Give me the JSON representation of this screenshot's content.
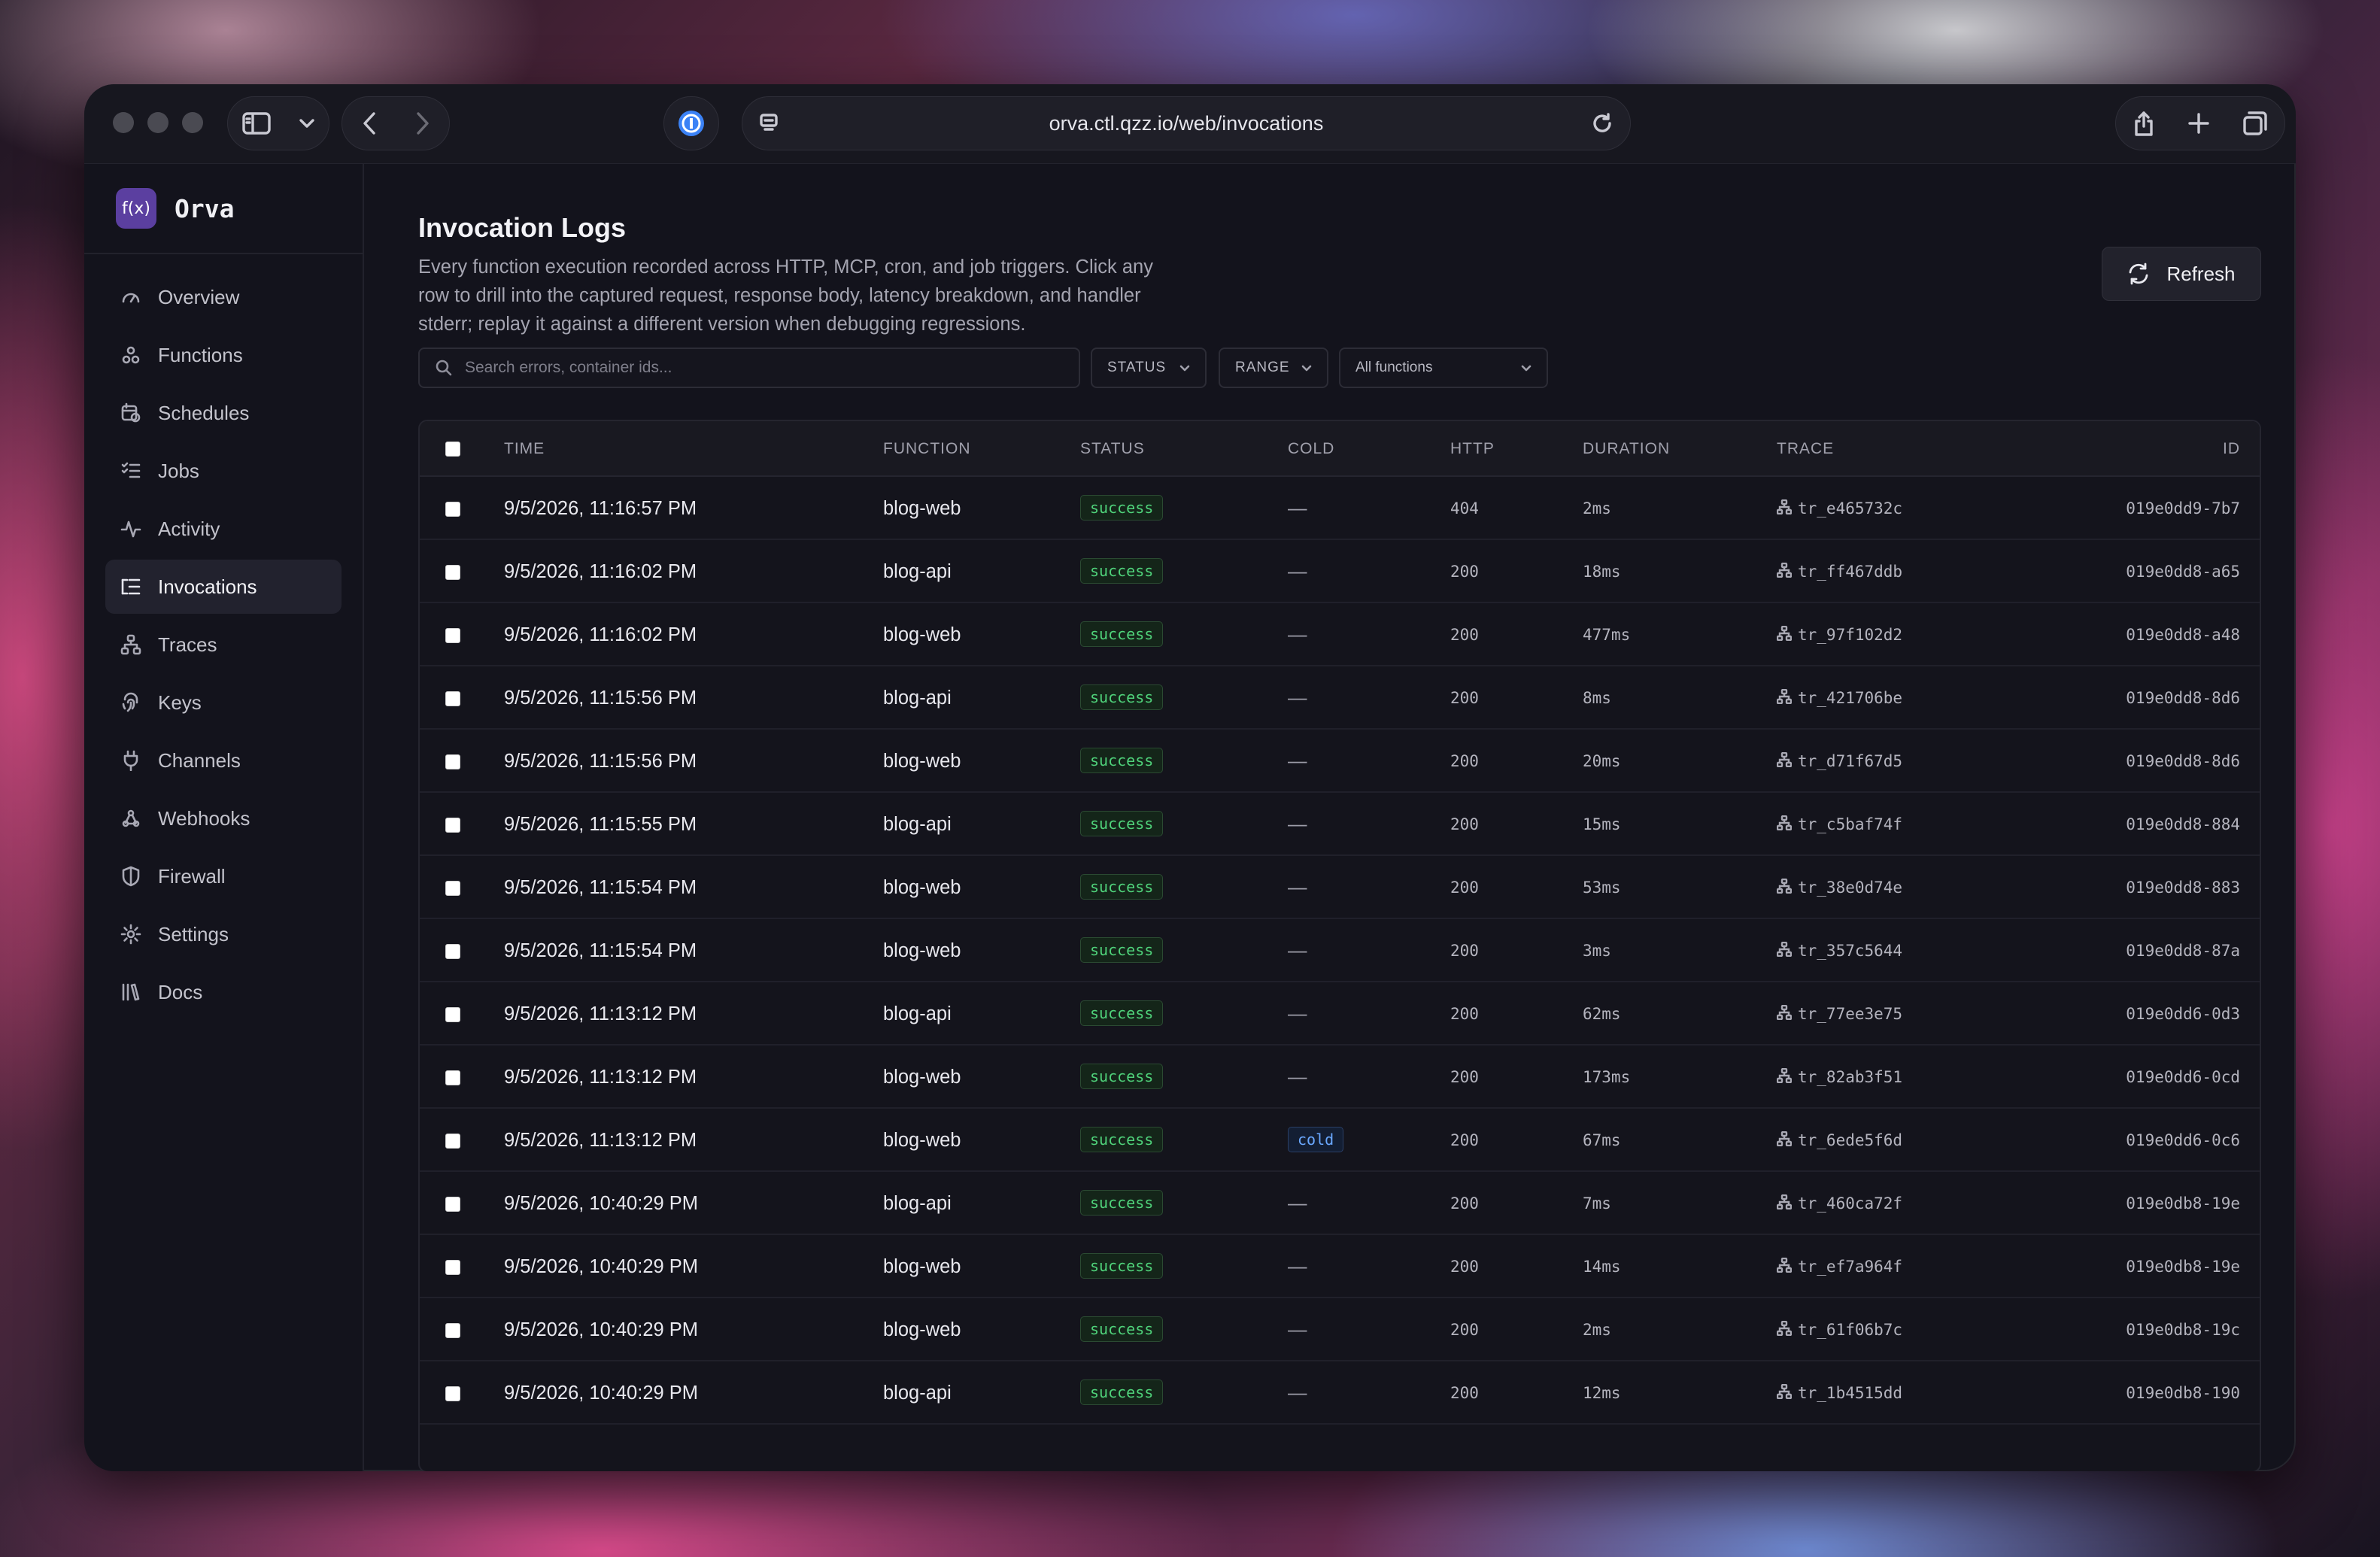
{
  "browser": {
    "url": "orva.ctl.qzz.io/web/invocations"
  },
  "sidebar": {
    "brand_logo": "f(x)",
    "brand_name": "Orva",
    "items": [
      {
        "label": "Overview",
        "icon": "gauge-icon"
      },
      {
        "label": "Functions",
        "icon": "functions-icon"
      },
      {
        "label": "Schedules",
        "icon": "calendar-clock-icon"
      },
      {
        "label": "Jobs",
        "icon": "list-check-icon"
      },
      {
        "label": "Activity",
        "icon": "activity-icon"
      },
      {
        "label": "Invocations",
        "icon": "list-icon",
        "active": true
      },
      {
        "label": "Traces",
        "icon": "network-icon"
      },
      {
        "label": "Keys",
        "icon": "fingerprint-icon"
      },
      {
        "label": "Channels",
        "icon": "plug-icon"
      },
      {
        "label": "Webhooks",
        "icon": "webhook-icon"
      },
      {
        "label": "Firewall",
        "icon": "shield-icon"
      },
      {
        "label": "Settings",
        "icon": "gear-icon"
      },
      {
        "label": "Docs",
        "icon": "library-icon"
      }
    ]
  },
  "page": {
    "title": "Invocation Logs",
    "description": "Every function execution recorded across HTTP, MCP, cron, and job triggers. Click any row to drill into the captured request, response body, latency breakdown, and handler stderr; replay it against a different version when debugging regressions.",
    "refresh_label": "Refresh"
  },
  "filters": {
    "search_placeholder": "Search errors, container ids...",
    "status_label": "STATUS",
    "range_label": "RANGE",
    "function_label": "All functions"
  },
  "table": {
    "columns": {
      "time": "TIME",
      "function": "FUNCTION",
      "status": "STATUS",
      "cold": "COLD",
      "http": "HTTP",
      "duration": "DURATION",
      "trace": "TRACE",
      "id": "ID"
    },
    "rows": [
      {
        "time": "9/5/2026, 11:16:57 PM",
        "function": "blog-web",
        "status": "success",
        "cold": "—",
        "http": "404",
        "duration": "2ms",
        "trace": "tr_e465732c",
        "id": "019e0dd9-7b7"
      },
      {
        "time": "9/5/2026, 11:16:02 PM",
        "function": "blog-api",
        "status": "success",
        "cold": "—",
        "http": "200",
        "duration": "18ms",
        "trace": "tr_ff467ddb",
        "id": "019e0dd8-a65"
      },
      {
        "time": "9/5/2026, 11:16:02 PM",
        "function": "blog-web",
        "status": "success",
        "cold": "—",
        "http": "200",
        "duration": "477ms",
        "trace": "tr_97f102d2",
        "id": "019e0dd8-a48"
      },
      {
        "time": "9/5/2026, 11:15:56 PM",
        "function": "blog-api",
        "status": "success",
        "cold": "—",
        "http": "200",
        "duration": "8ms",
        "trace": "tr_421706be",
        "id": "019e0dd8-8d6"
      },
      {
        "time": "9/5/2026, 11:15:56 PM",
        "function": "blog-web",
        "status": "success",
        "cold": "—",
        "http": "200",
        "duration": "20ms",
        "trace": "tr_d71f67d5",
        "id": "019e0dd8-8d6"
      },
      {
        "time": "9/5/2026, 11:15:55 PM",
        "function": "blog-api",
        "status": "success",
        "cold": "—",
        "http": "200",
        "duration": "15ms",
        "trace": "tr_c5baf74f",
        "id": "019e0dd8-884"
      },
      {
        "time": "9/5/2026, 11:15:54 PM",
        "function": "blog-web",
        "status": "success",
        "cold": "—",
        "http": "200",
        "duration": "53ms",
        "trace": "tr_38e0d74e",
        "id": "019e0dd8-883"
      },
      {
        "time": "9/5/2026, 11:15:54 PM",
        "function": "blog-web",
        "status": "success",
        "cold": "—",
        "http": "200",
        "duration": "3ms",
        "trace": "tr_357c5644",
        "id": "019e0dd8-87a"
      },
      {
        "time": "9/5/2026, 11:13:12 PM",
        "function": "blog-api",
        "status": "success",
        "cold": "—",
        "http": "200",
        "duration": "62ms",
        "trace": "tr_77ee3e75",
        "id": "019e0dd6-0d3"
      },
      {
        "time": "9/5/2026, 11:13:12 PM",
        "function": "blog-web",
        "status": "success",
        "cold": "—",
        "http": "200",
        "duration": "173ms",
        "trace": "tr_82ab3f51",
        "id": "019e0dd6-0cd"
      },
      {
        "time": "9/5/2026, 11:13:12 PM",
        "function": "blog-web",
        "status": "success",
        "cold": "cold",
        "http": "200",
        "duration": "67ms",
        "trace": "tr_6ede5f6d",
        "id": "019e0dd6-0c6"
      },
      {
        "time": "9/5/2026, 10:40:29 PM",
        "function": "blog-api",
        "status": "success",
        "cold": "—",
        "http": "200",
        "duration": "7ms",
        "trace": "tr_460ca72f",
        "id": "019e0db8-19e"
      },
      {
        "time": "9/5/2026, 10:40:29 PM",
        "function": "blog-web",
        "status": "success",
        "cold": "—",
        "http": "200",
        "duration": "14ms",
        "trace": "tr_ef7a964f",
        "id": "019e0db8-19e"
      },
      {
        "time": "9/5/2026, 10:40:29 PM",
        "function": "blog-web",
        "status": "success",
        "cold": "—",
        "http": "200",
        "duration": "2ms",
        "trace": "tr_61f06b7c",
        "id": "019e0db8-19c"
      },
      {
        "time": "9/5/2026, 10:40:29 PM",
        "function": "blog-api",
        "status": "success",
        "cold": "—",
        "http": "200",
        "duration": "12ms",
        "trace": "tr_1b4515dd",
        "id": "019e0db8-190"
      }
    ]
  }
}
